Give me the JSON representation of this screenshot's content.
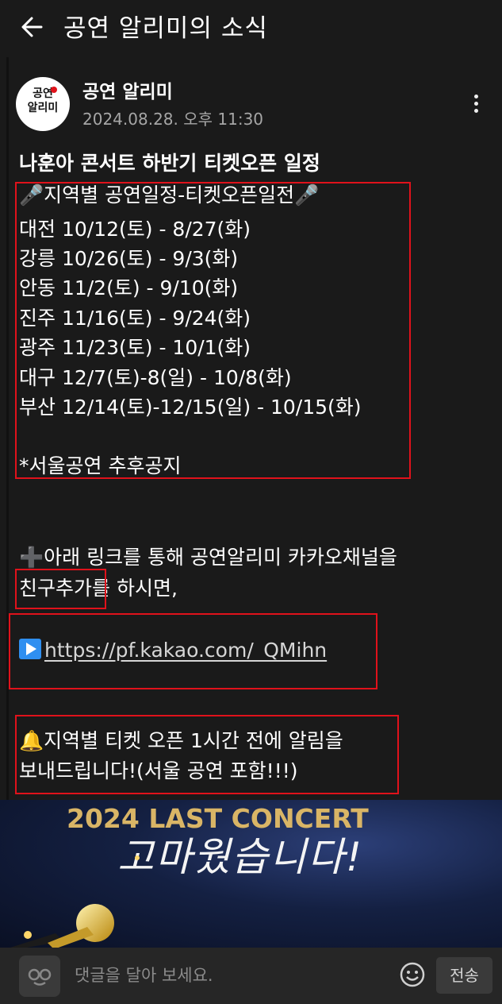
{
  "header": {
    "title": "공연 알리미의 소식",
    "back_icon": "arrow-left-icon"
  },
  "post": {
    "avatar_text_line1": "공연",
    "avatar_text_line2": "알리미",
    "channel_name": "공연 알리미",
    "date": "2024.08.28. 오후 11:30",
    "more_icon": "more-vertical-icon",
    "title": "나훈아 콘서트 하반기 티켓오픈 일정",
    "schedule_heading": "🎤지역별 공연일정-티켓오픈일전🎤",
    "schedule": [
      "대전 10/12(토) - 8/27(화)",
      "강릉 10/26(토) - 9/3(화)",
      "안동 11/2(토) - 9/10(화)",
      "진주 11/16(토) - 9/24(화)",
      "광주 11/23(토) - 10/1(화)",
      "대구 12/7(토)-8(일) - 10/8(화)",
      "부산 12/14(토)-12/15(일) - 10/15(화)"
    ],
    "seoul_note": "*서울공연 추후공지",
    "friend_text_1": "➕아래 링크를 통해 공연알리미 카카오채널을",
    "friend_text_2a": "친구추가",
    "friend_text_2b": "를 하시면,",
    "link_url": "https://pf.kakao.com/_QMihn",
    "alert_text_1": "🔔지역별 티켓 오픈 1시간 전에 알림을",
    "alert_text_2": "보내드립니다!(서울 공연 포함!!!)"
  },
  "banner": {
    "subtitle": "2024 LAST CONCERT",
    "main": "고마웠습니다!"
  },
  "comment_bar": {
    "placeholder": "댓글을 달아 보세요.",
    "send_label": "전송",
    "emoji_icon": "emoticon-icon",
    "smile_icon": "smile-icon"
  },
  "colors": {
    "highlight": "#e0121b",
    "background": "#1a1a1a",
    "date_text": "#a6a6a6"
  }
}
